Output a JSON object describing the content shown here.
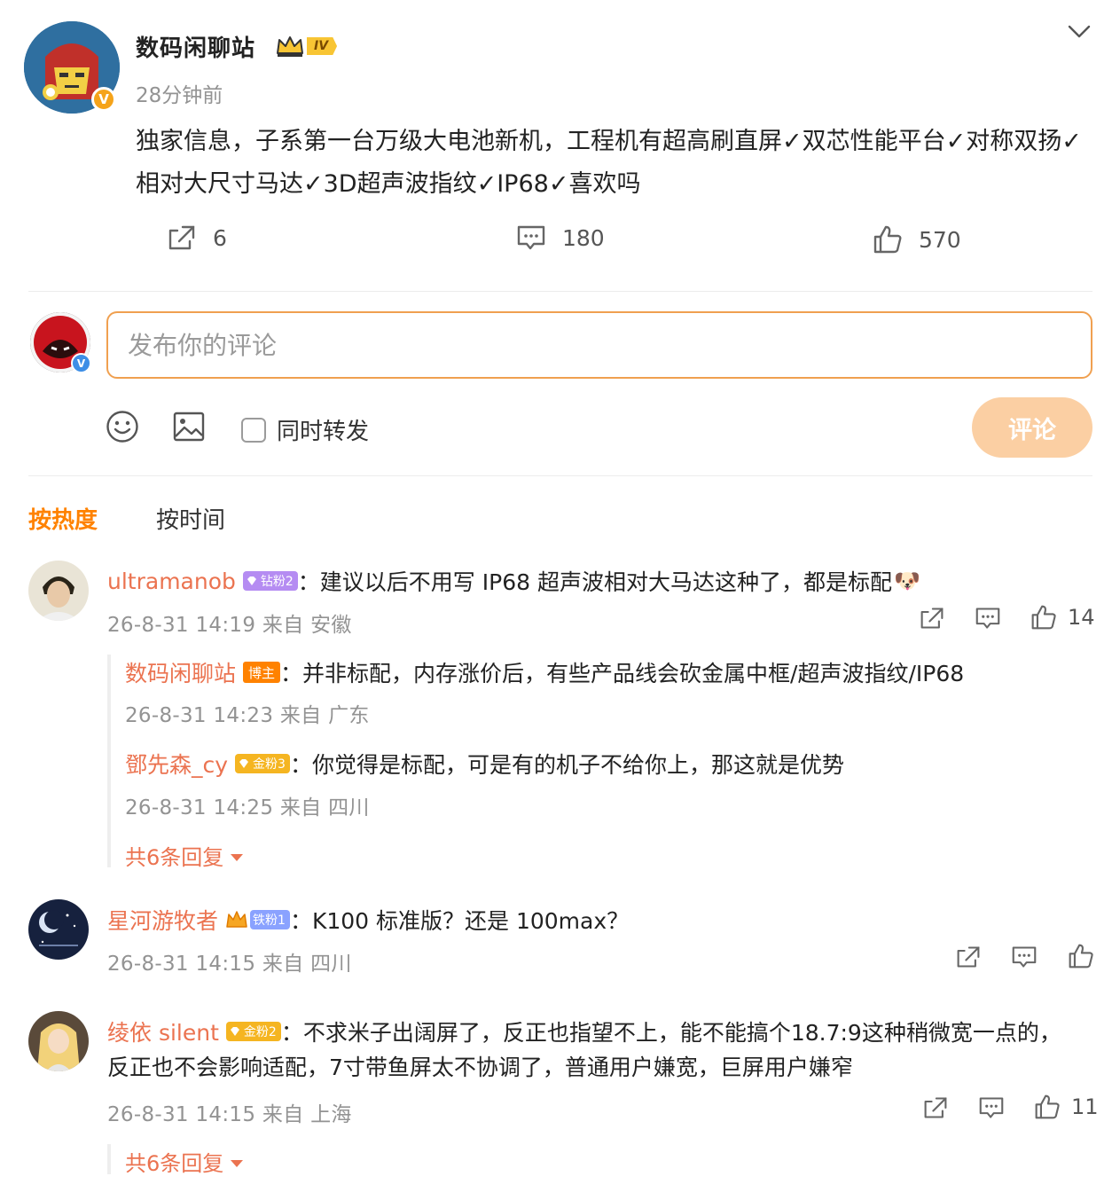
{
  "post": {
    "author": "数码闲聊站",
    "level_badge": "IV",
    "time": "28分钟前",
    "text": "独家信息，子系第一台万级大电池新机，工程机有超高刷直屏✓双芯性能平台✓对称双扬✓相对大尺寸马达✓3D超声波指纹✓IP68✓喜欢吗",
    "repost_count": "6",
    "comment_count": "180",
    "like_count": "570",
    "verified_mark": "V"
  },
  "compose": {
    "placeholder": "发布你的评论",
    "repost_label": "同时转发",
    "submit_label": "评论",
    "verified_mark": "V"
  },
  "tabs": {
    "hot": "按热度",
    "time": "按时间"
  },
  "comments": [
    {
      "name": "ultramanob",
      "fan_badge": "钻粉2",
      "text": "：建议以后不用写 IP68 超声波相对大马达这种了，都是标配",
      "emoji": "🐶",
      "meta": "26-8-31 14:19 来自 安徽",
      "likes": "14",
      "replies": [
        {
          "name": "数码闲聊站",
          "badge": "博主",
          "text": "：并非标配，内存涨价后，有些产品线会砍金属中框/超声波指纹/IP68",
          "meta": "26-8-31 14:23 来自 广东"
        },
        {
          "name": "鄧先森_cy",
          "badge": "金粉3",
          "text": "：你觉得是标配，可是有的机子不给你上，那这就是优势",
          "meta": "26-8-31 14:25 来自 四川"
        }
      ],
      "more": "共6条回复"
    },
    {
      "name": "星河游牧者",
      "fan_badge": "铁粉1",
      "text": "：K100 标准版？还是 100max？",
      "meta": "26-8-31 14:15 来自 四川"
    },
    {
      "name": "绫依 silent",
      "fan_badge": "金粉2",
      "text": "：不求米子出阔屏了，反正也指望不上，能不能搞个18.7:9这种稍微宽一点的，",
      "text2": "反正也不会影响适配，7寸带鱼屏太不协调了，普通用户嫌宽，巨屏用户嫌窄",
      "meta": "26-8-31 14:15 来自 上海",
      "likes": "11",
      "more": "共6条回复"
    }
  ],
  "colors": {
    "accent": "#ff8200",
    "name": "#eb7350",
    "submit_disabled": "#fbcfa3",
    "input_border": "#f0a050"
  },
  "icons": [
    "chevron-down-icon",
    "repost-icon",
    "comment-icon",
    "like-icon",
    "emoji-icon",
    "image-icon"
  ]
}
